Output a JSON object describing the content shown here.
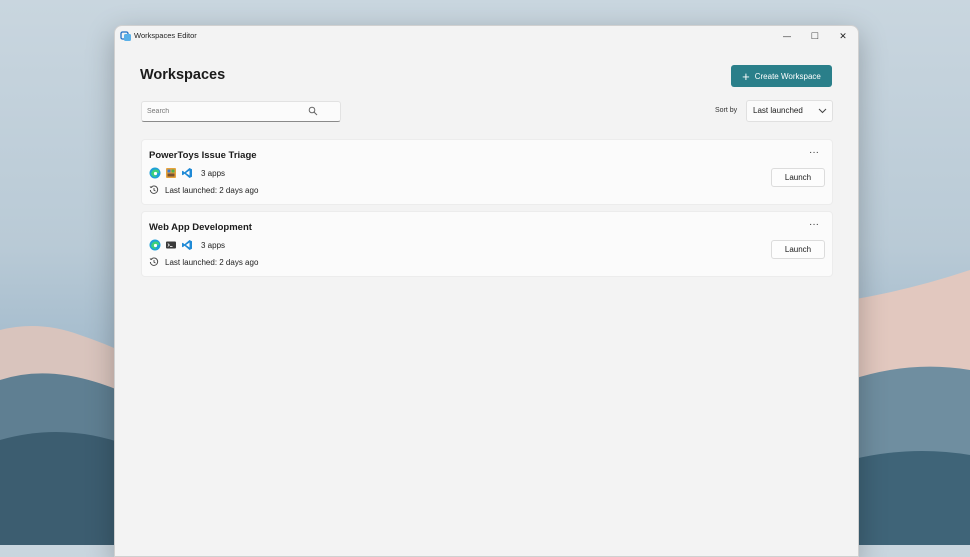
{
  "window": {
    "title": "Workspaces Editor",
    "minimize_glyph": "—",
    "maximize_glyph": "□",
    "close_glyph": "✕"
  },
  "header": {
    "page_title": "Workspaces",
    "create_button_label": "Create Workspace",
    "accent_color": "#2a7f8a"
  },
  "search": {
    "placeholder": "Search",
    "value": ""
  },
  "sort": {
    "label": "Sort by",
    "selected": "Last launched"
  },
  "workspaces": [
    {
      "name": "PowerToys Issue Triage",
      "app_icons": [
        "edge-icon",
        "app-icon",
        "vscode-icon"
      ],
      "apps_count": "3 apps",
      "last_launched": "Last launched: 2 days ago",
      "more_glyph": "···",
      "launch_label": "Launch"
    },
    {
      "name": "Web App Development",
      "app_icons": [
        "edge-icon",
        "terminal-icon",
        "vscode-icon"
      ],
      "apps_count": "3 apps",
      "last_launched": "Last launched: 2 days ago",
      "more_glyph": "···",
      "launch_label": "Launch"
    }
  ]
}
